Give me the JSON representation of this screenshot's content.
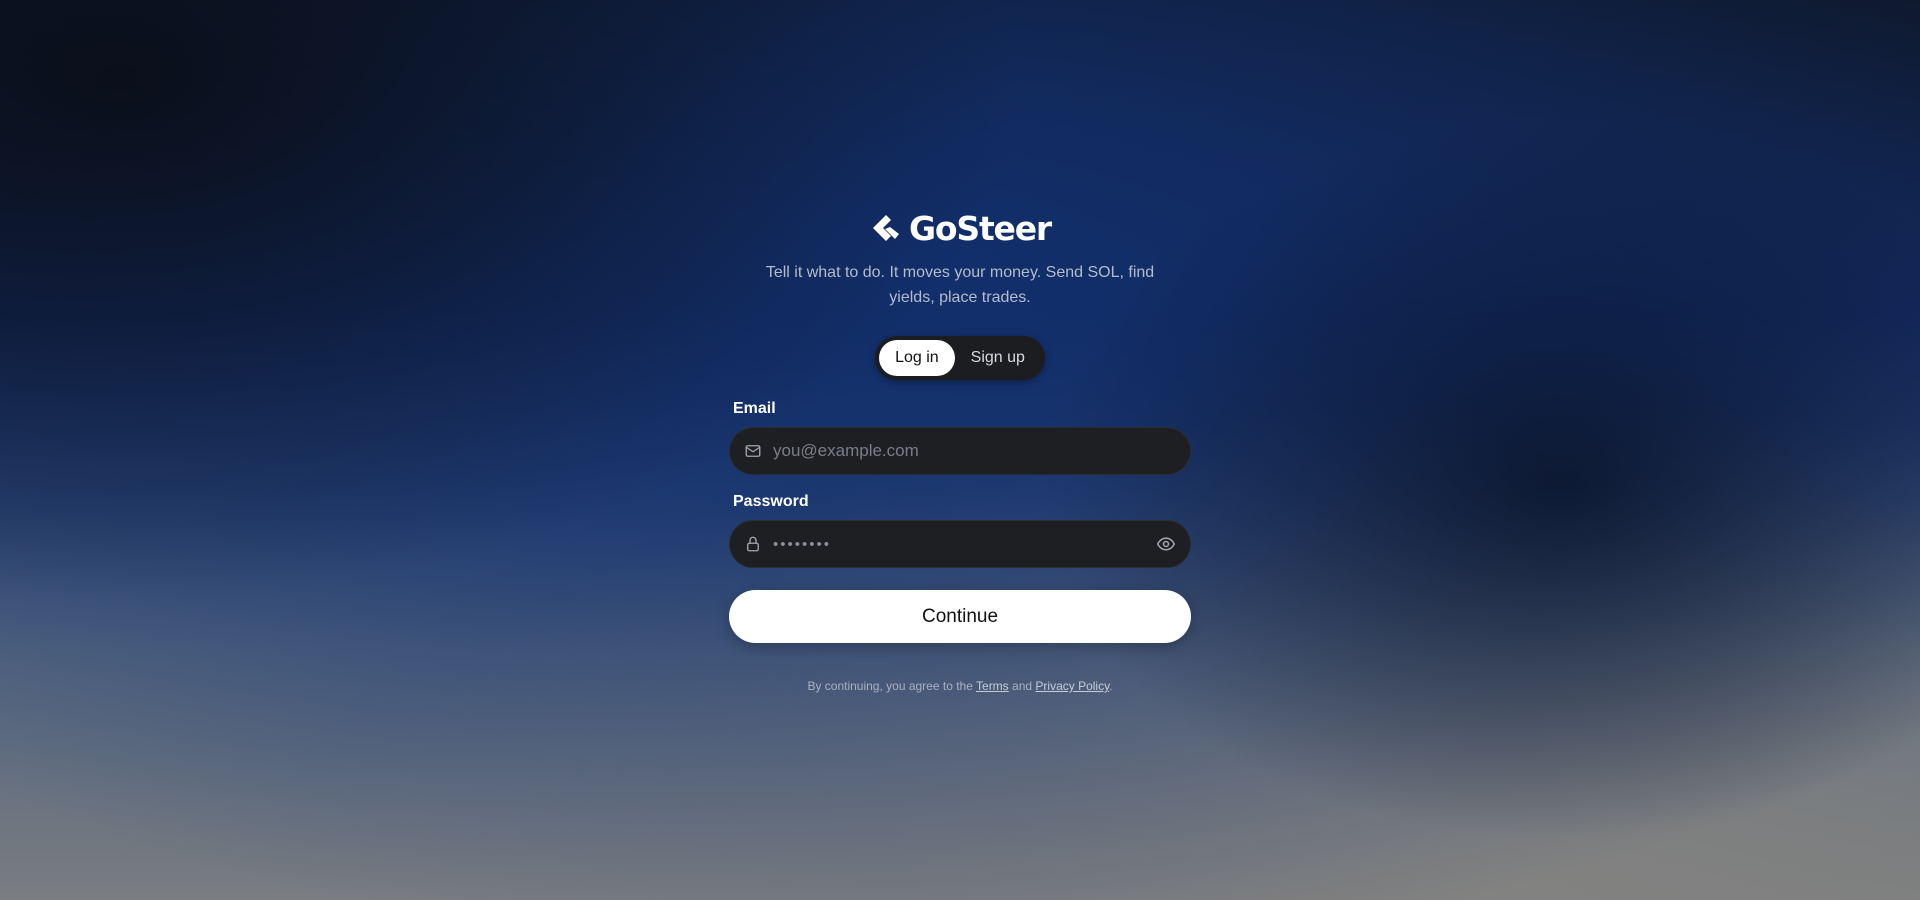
{
  "brand": {
    "name": "GoSteer",
    "tagline": "Tell it what to do. It moves your money. Send SOL, find yields, place trades."
  },
  "auth_toggle": {
    "login_label": "Log in",
    "signup_label": "Sign up",
    "active": "login"
  },
  "form": {
    "email": {
      "label": "Email",
      "placeholder": "you@example.com",
      "value": "",
      "icon": "mail-icon"
    },
    "password": {
      "label": "Password",
      "placeholder": "••••••••",
      "value": "",
      "icon": "lock-icon",
      "toggle_icon": "eye-icon"
    },
    "submit_label": "Continue"
  },
  "legal": {
    "prefix": "By continuing, you agree to the",
    "terms_label": "Terms",
    "conjunction": "and",
    "privacy_label": "Privacy Policy",
    "suffix": "."
  },
  "colors": {
    "accent": "#ffffff",
    "input_bg": "#1e1f23",
    "toggle_bg": "#1c1d21",
    "muted_text": "#b4bccb"
  }
}
